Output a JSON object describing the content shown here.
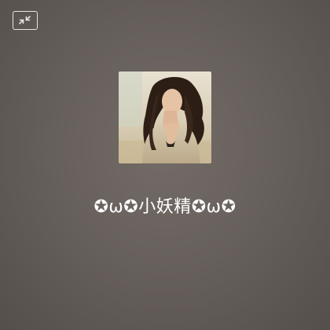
{
  "call_screen": {
    "minimize_icon": "shrink-arrows-icon",
    "caller": {
      "name": "✪ω✪小妖精✪ω✪",
      "avatar": "caller-avatar-photo"
    },
    "colors": {
      "background": "#67605c",
      "icon_stroke": "#e8e4e1",
      "name_text": "#ffffff"
    }
  }
}
